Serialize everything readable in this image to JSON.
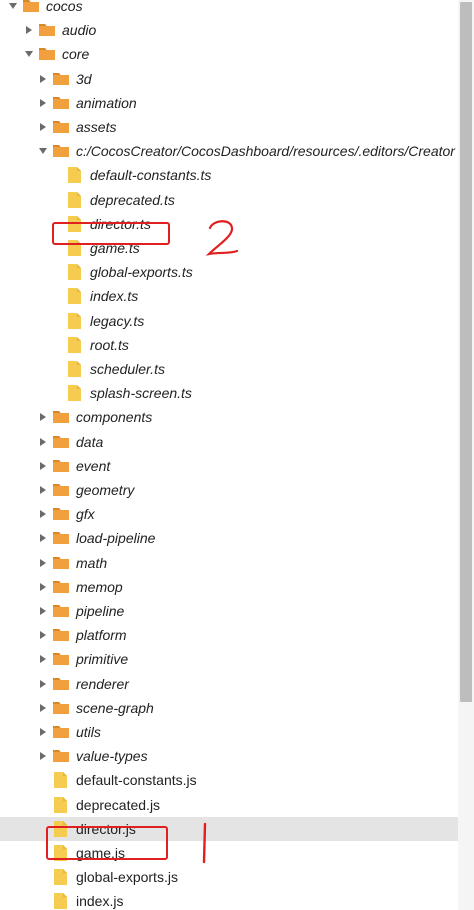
{
  "tree": [
    {
      "label": "cocos",
      "kind": "folder",
      "open": true
    },
    {
      "label": "audio",
      "kind": "folder",
      "open": false
    },
    {
      "label": "core",
      "kind": "folder",
      "open": true
    },
    {
      "label": "3d",
      "kind": "folder",
      "open": false
    },
    {
      "label": "animation",
      "kind": "folder",
      "open": false
    },
    {
      "label": "assets",
      "kind": "folder",
      "open": false
    },
    {
      "label": "c:/CocosCreator/CocosDashboard/resources/.editors/Creator",
      "kind": "folder",
      "open": true
    },
    {
      "label": "default-constants.ts",
      "kind": "file"
    },
    {
      "label": "deprecated.ts",
      "kind": "file"
    },
    {
      "label": "director.ts",
      "kind": "file"
    },
    {
      "label": "game.ts",
      "kind": "file"
    },
    {
      "label": "global-exports.ts",
      "kind": "file"
    },
    {
      "label": "index.ts",
      "kind": "file"
    },
    {
      "label": "legacy.ts",
      "kind": "file"
    },
    {
      "label": "root.ts",
      "kind": "file"
    },
    {
      "label": "scheduler.ts",
      "kind": "file"
    },
    {
      "label": "splash-screen.ts",
      "kind": "file"
    },
    {
      "label": "components",
      "kind": "folder",
      "open": false
    },
    {
      "label": "data",
      "kind": "folder",
      "open": false
    },
    {
      "label": "event",
      "kind": "folder",
      "open": false
    },
    {
      "label": "geometry",
      "kind": "folder",
      "open": false
    },
    {
      "label": "gfx",
      "kind": "folder",
      "open": false
    },
    {
      "label": "load-pipeline",
      "kind": "folder",
      "open": false
    },
    {
      "label": "math",
      "kind": "folder",
      "open": false
    },
    {
      "label": "memop",
      "kind": "folder",
      "open": false
    },
    {
      "label": "pipeline",
      "kind": "folder",
      "open": false
    },
    {
      "label": "platform",
      "kind": "folder",
      "open": false
    },
    {
      "label": "primitive",
      "kind": "folder",
      "open": false
    },
    {
      "label": "renderer",
      "kind": "folder",
      "open": false
    },
    {
      "label": "scene-graph",
      "kind": "folder",
      "open": false
    },
    {
      "label": "utils",
      "kind": "folder",
      "open": false
    },
    {
      "label": "value-types",
      "kind": "folder",
      "open": false
    },
    {
      "label": "default-constants.js",
      "kind": "file"
    },
    {
      "label": "deprecated.js",
      "kind": "file"
    },
    {
      "label": "director.js",
      "kind": "file",
      "selected": true
    },
    {
      "label": "game.js",
      "kind": "file"
    },
    {
      "label": "global-exports.js",
      "kind": "file"
    },
    {
      "label": "index.js",
      "kind": "file"
    }
  ],
  "annotations": {
    "mark_top": "2",
    "mark_bottom": "|"
  },
  "colors": {
    "folder": "#f2a03d",
    "folder_tab": "#d9852a",
    "file": "#f5cc4f",
    "file_fold": "#e3b83a",
    "annotation": "#e02020",
    "selected_row": "#e4e4e4"
  },
  "icons": {
    "folder": "folder-icon",
    "file": "file-icon",
    "caret_open": "chevron-down-icon",
    "caret_closed": "chevron-right-icon"
  }
}
